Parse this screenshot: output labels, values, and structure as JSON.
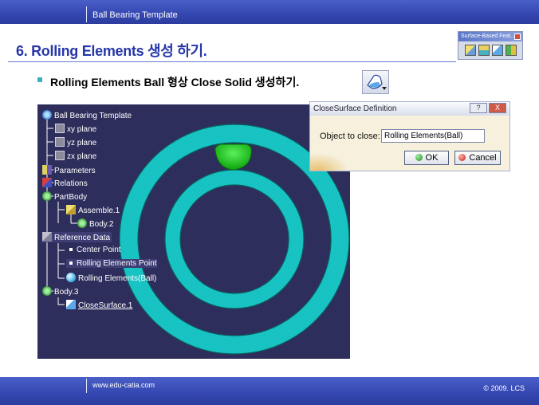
{
  "header": {
    "title": "Ball Bearing Template"
  },
  "slide": {
    "title": "6. Rolling Elements 생성 하기.",
    "bullet": "Rolling Elements Ball 형상 Close Solid 생성하기."
  },
  "toolbar": {
    "title": "Surface-Based Feat..."
  },
  "tree": {
    "root": "Ball Bearing Template",
    "xy": "xy plane",
    "yz": "yz plane",
    "zx": "zx plane",
    "parameters": "Parameters",
    "relations": "Relations",
    "partbody": "PartBody",
    "assemble": "Assemble.1",
    "body2": "Body.2",
    "refdata": "Reference Data",
    "center": "Center Point",
    "repoint": "Rolling Elements Point",
    "reball": "Rolling Elements(Ball)",
    "body3": "Body.3",
    "closesurface": "CloseSurface.1"
  },
  "dialog": {
    "title": "CloseSurface Definition",
    "help": "?",
    "close": "X",
    "label": "Object to close:",
    "value": "Rolling Elements(Ball)",
    "ok": "OK",
    "cancel": "Cancel"
  },
  "footer": {
    "url": "www.edu-catia.com",
    "copyright": "© 2009. LCS"
  },
  "colors": {
    "ring": "#19c8c8",
    "ball": "#19c819",
    "viewport": "#2e2e5c",
    "bar": "#3446b0"
  }
}
